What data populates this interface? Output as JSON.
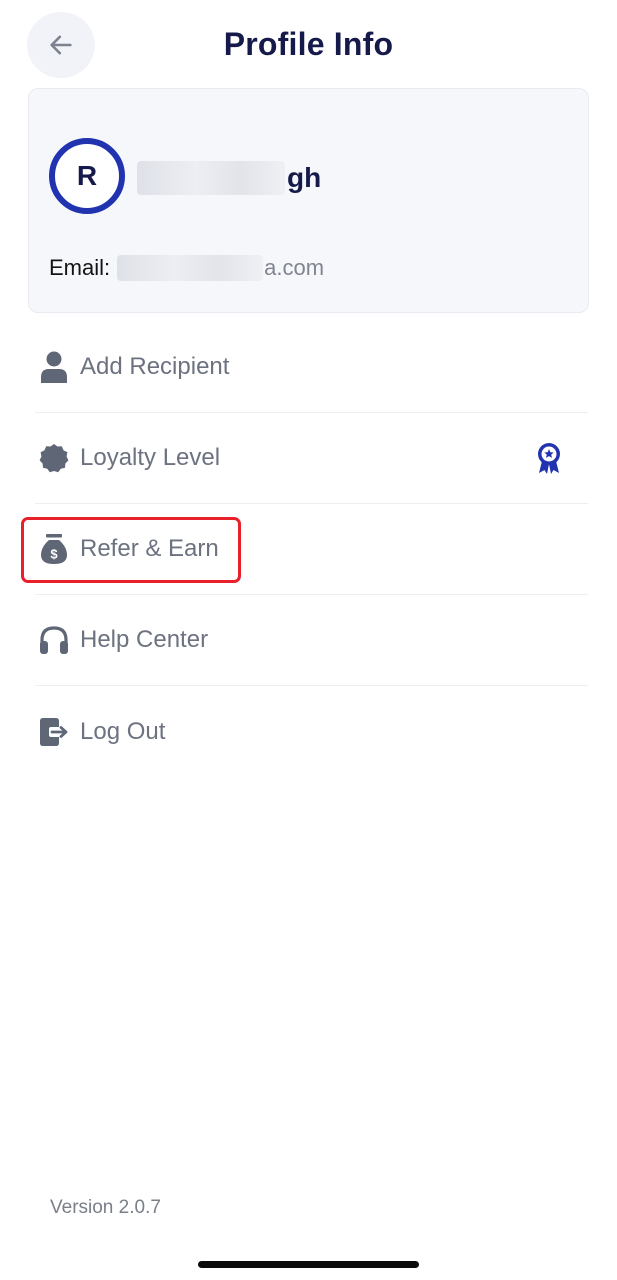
{
  "header": {
    "title": "Profile Info",
    "back_icon": "arrow-left-icon"
  },
  "profile": {
    "avatar_initial": "R",
    "name_visible_suffix": "gh",
    "email_label": "Email:",
    "email_visible_suffix": "a.com"
  },
  "menu": {
    "items": [
      {
        "label": "Add Recipient",
        "icon": "person-icon"
      },
      {
        "label": "Loyalty Level",
        "icon": "badge-icon",
        "trailing_icon": "award-ribbon-icon"
      },
      {
        "label": "Refer & Earn",
        "icon": "money-bag-icon",
        "highlighted": true
      },
      {
        "label": "Help Center",
        "icon": "headphones-icon"
      },
      {
        "label": "Log Out",
        "icon": "logout-icon"
      }
    ]
  },
  "footer": {
    "version": "Version 2.0.7"
  },
  "colors": {
    "title": "#161a4a",
    "avatar_ring": "#2233b0",
    "menu_text": "#6c7280",
    "menu_icon": "#5f6675",
    "highlight": "#e8202a",
    "award_icon": "#2233b0"
  }
}
